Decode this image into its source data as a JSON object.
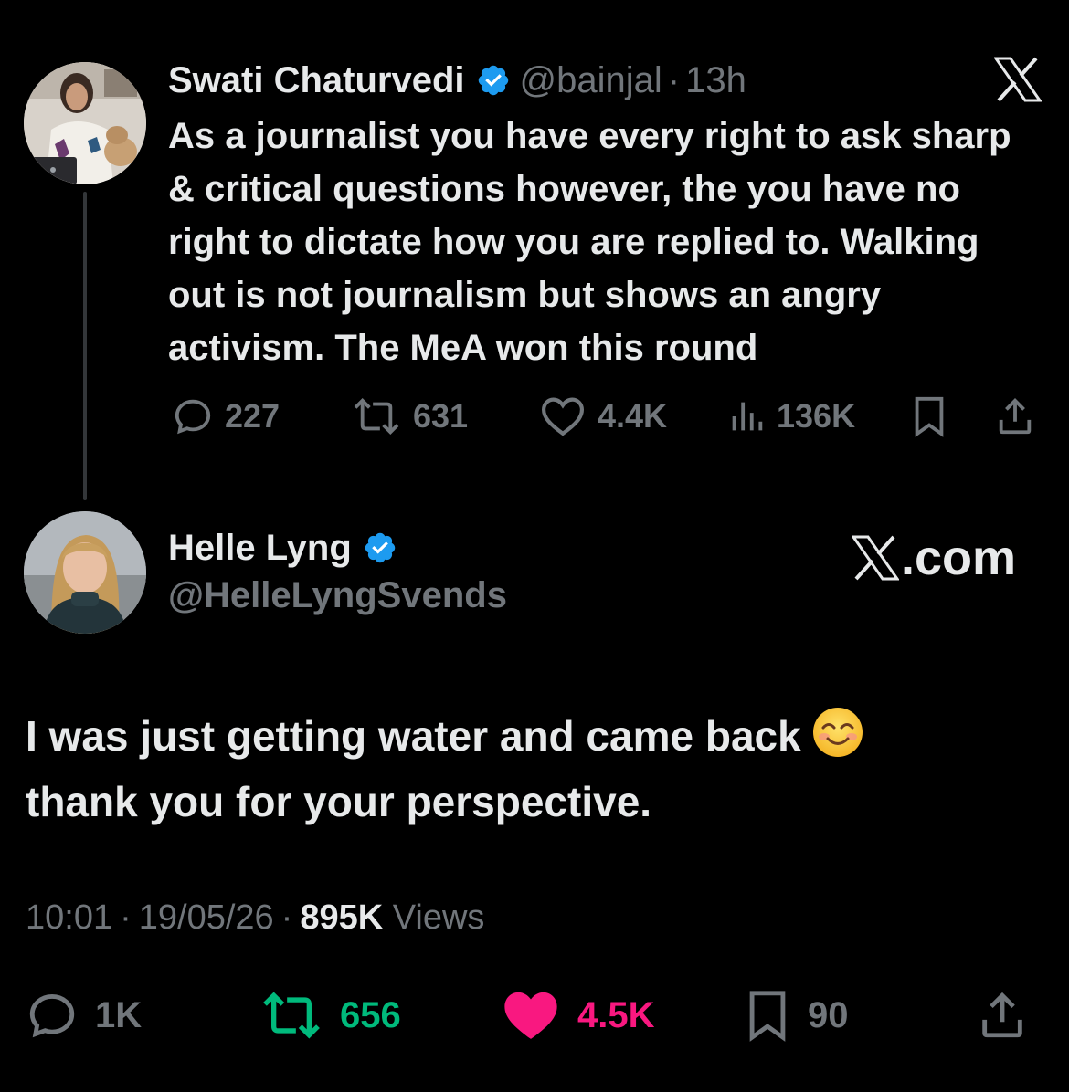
{
  "reply_tweet": {
    "author_name": "Swati Chaturvedi",
    "handle": "@bainjal",
    "time": "13h",
    "separator": "·",
    "text": "As a journalist you have every right to ask sharp & critical questions however, the you have no right to dictate how you are replied to. Walking out is not journalism but shows an angry activism. The MeA won this round",
    "stats": {
      "replies": "227",
      "reposts": "631",
      "likes": "4.4K",
      "views": "136K"
    }
  },
  "main_tweet": {
    "author_name": "Helle Lyng",
    "handle": "@HelleLyngSvends",
    "watermark": ".com",
    "text": "I was just getting water and came back",
    "text_line2": "thank you for your perspective.",
    "emoji": "smiling-face-icon",
    "time": "10:01",
    "date": "19/05/26",
    "separator": "·",
    "views_count": "895K",
    "views_label": "Views",
    "stats": {
      "replies": "1K",
      "reposts": "656",
      "likes": "4.5K",
      "bookmarks": "90"
    }
  },
  "colors": {
    "background": "#000000",
    "text": "#e7e9ea",
    "muted": "#71767b",
    "verified": "#1d9bf0",
    "repost_active": "#00ba7c",
    "like_active": "#f91880"
  }
}
